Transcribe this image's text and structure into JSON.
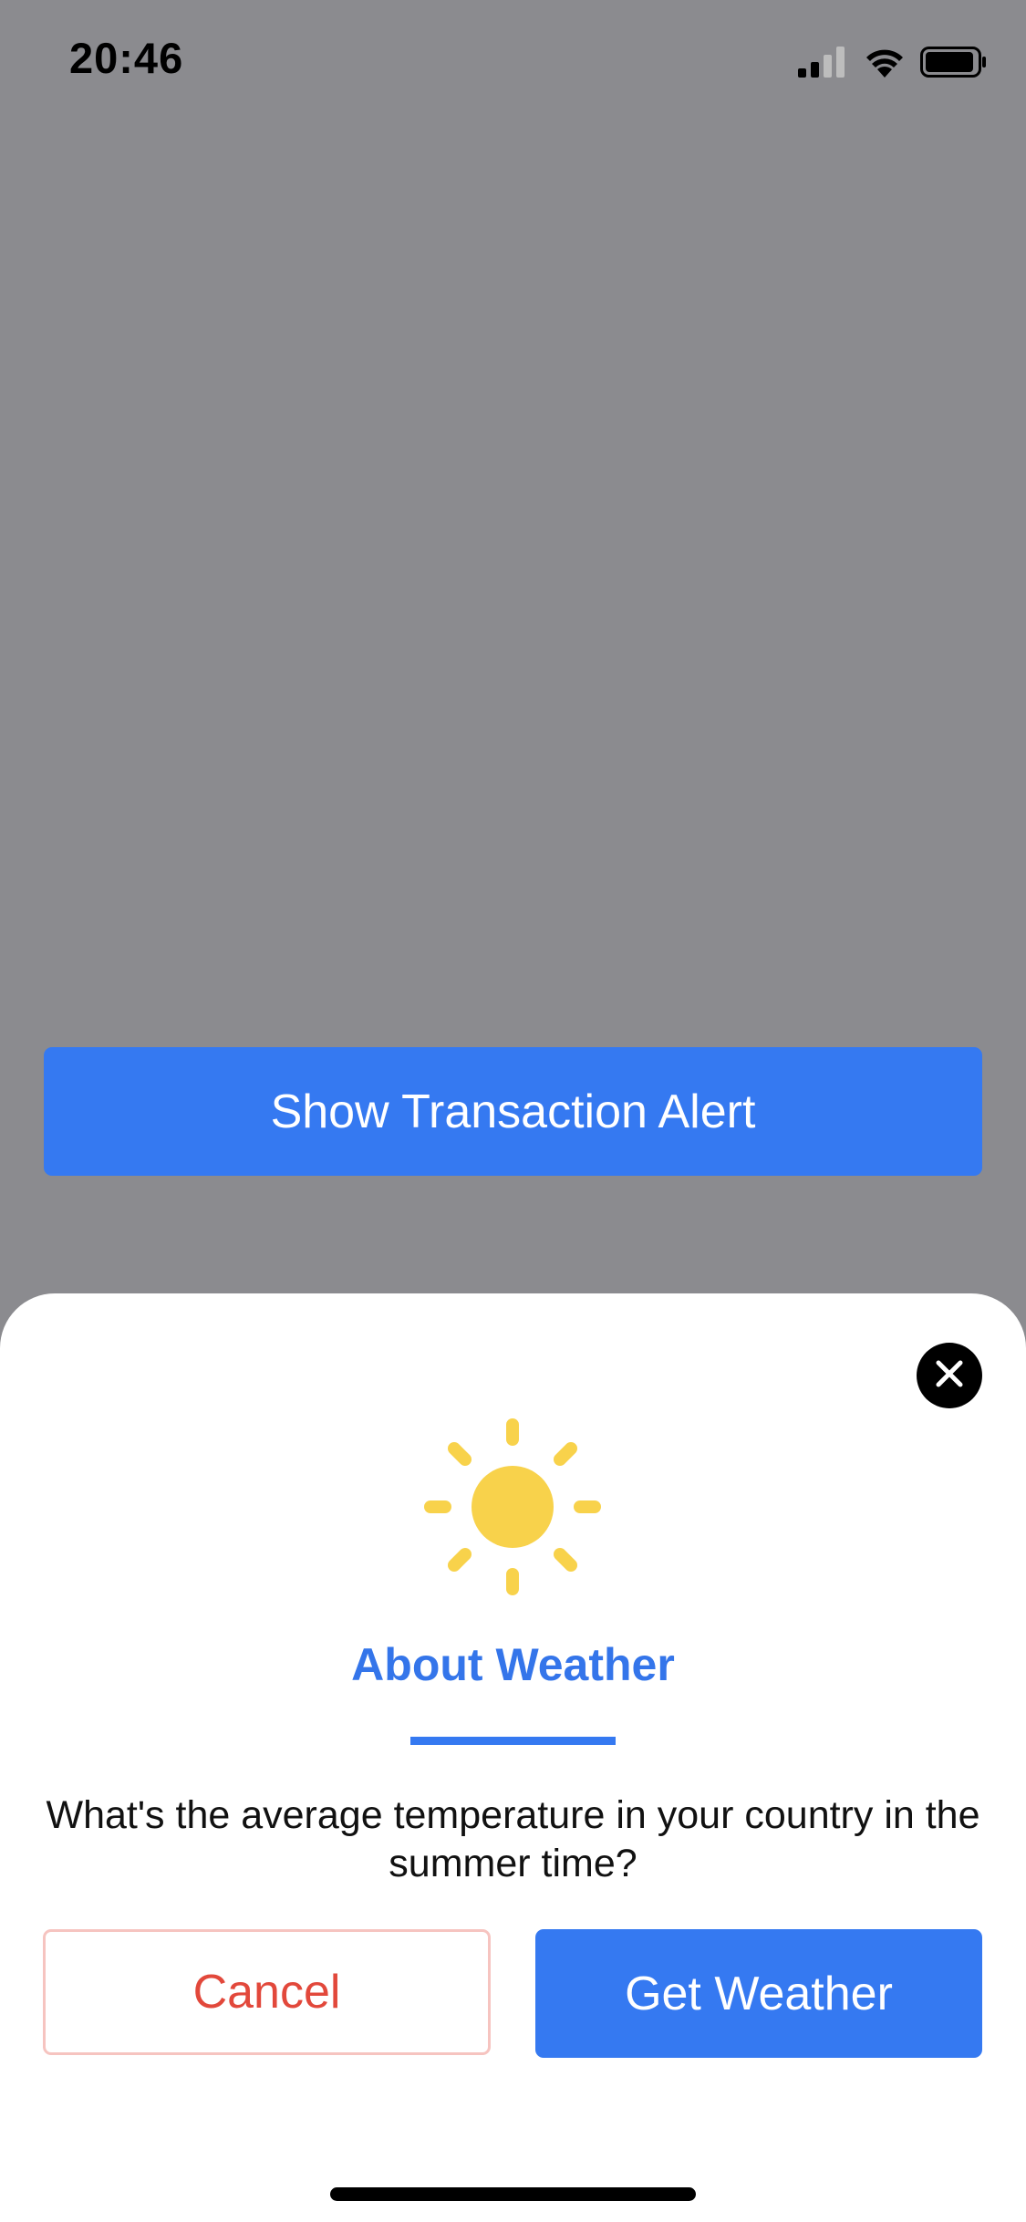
{
  "status_bar": {
    "time": "20:46",
    "icons": [
      "signal-icon",
      "wifi-icon",
      "battery-icon"
    ]
  },
  "main": {
    "button_label": "Show Transaction Alert"
  },
  "sheet": {
    "icon": "sun-icon",
    "title": "About Weather",
    "message": "What's the average temperature in your country in the summer time?",
    "cancel_label": "Cancel",
    "confirm_label": "Get Weather",
    "close_icon": "close-icon"
  },
  "colors": {
    "background_dim": "#8b8b8f",
    "accent": "#3579f1",
    "title": "#3475ea",
    "cancel_text": "#e2483b",
    "cancel_border": "#f6c4c0",
    "sun": "#f8d24b"
  }
}
